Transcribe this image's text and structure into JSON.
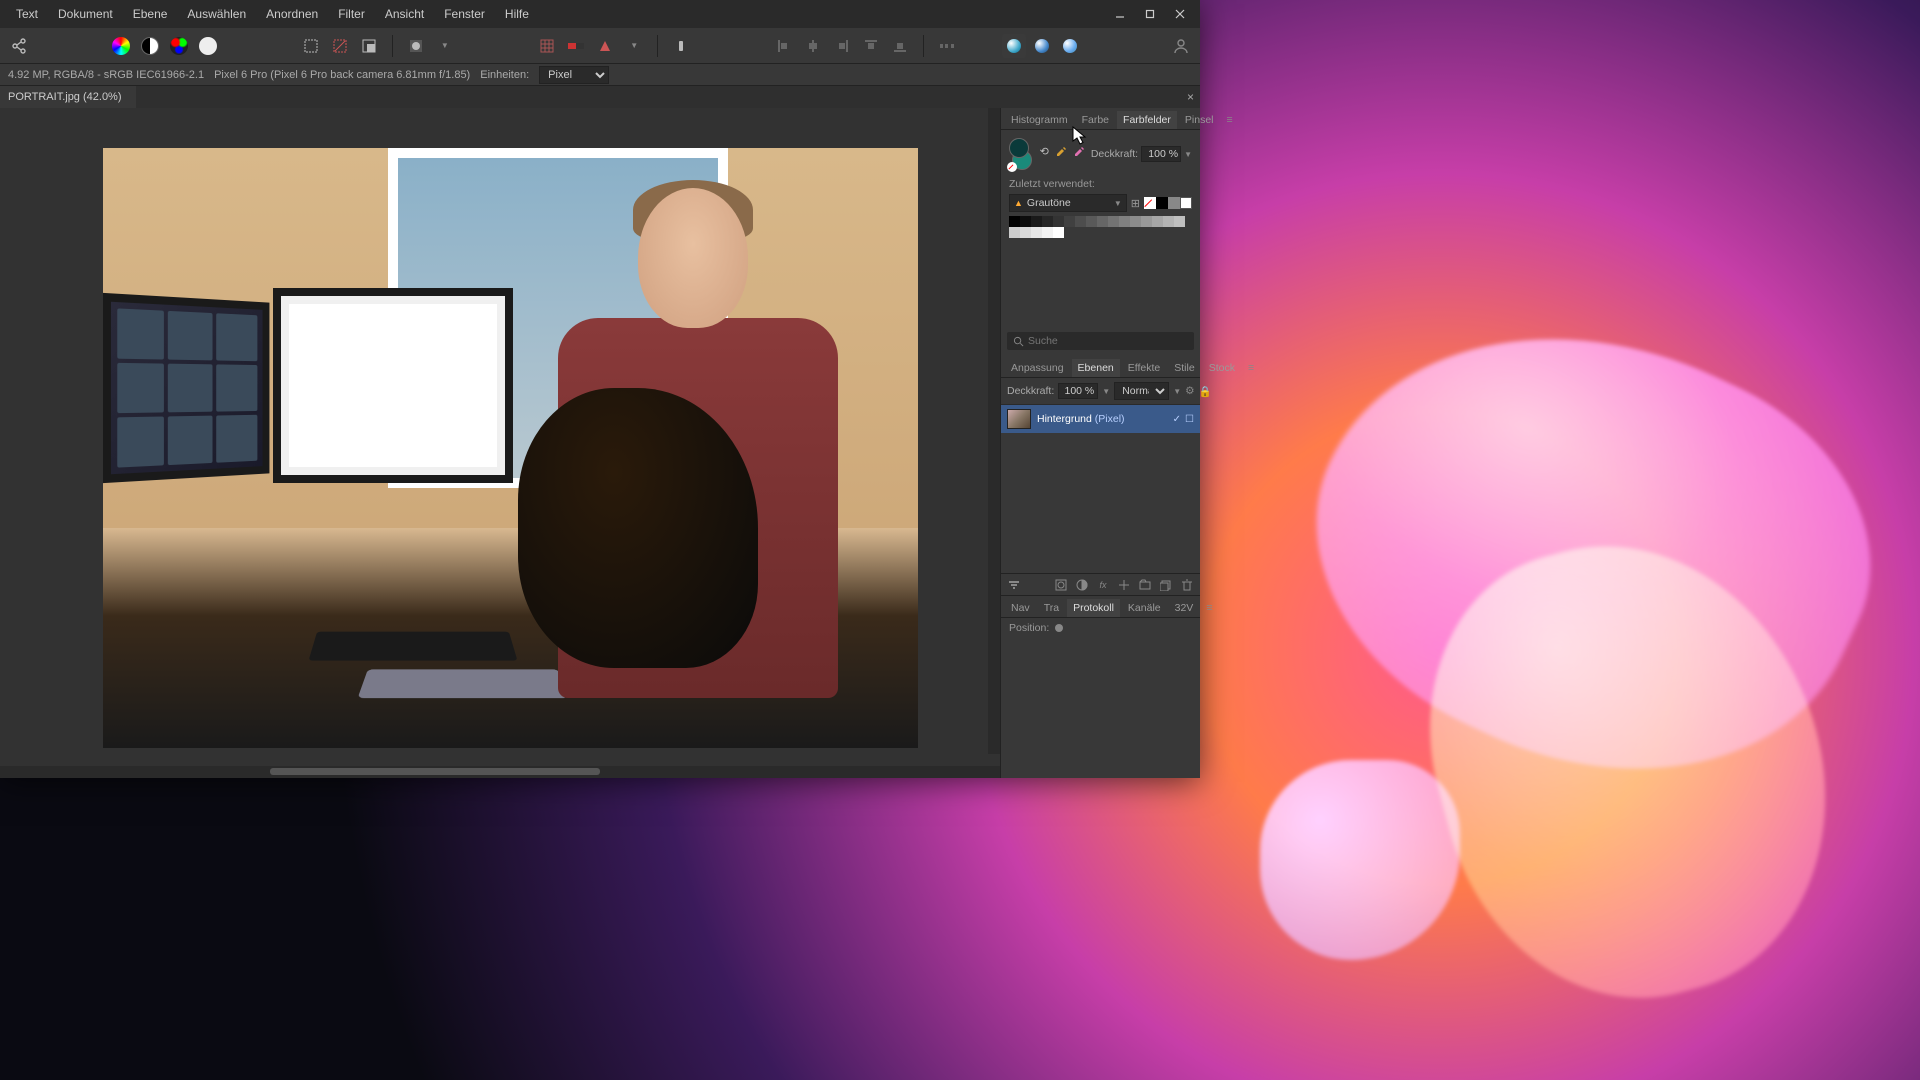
{
  "menubar": [
    "Text",
    "Dokument",
    "Ebene",
    "Auswählen",
    "Anordnen",
    "Filter",
    "Ansicht",
    "Fenster",
    "Hilfe"
  ],
  "infobar": {
    "resolution": "4.92 MP, RGBA/8 - sRGB IEC61966-2.1",
    "camera": "Pixel 6 Pro (Pixel 6 Pro back camera 6.81mm f/1.85)",
    "units_label": "Einheiten:",
    "units_value": "Pixel"
  },
  "doc_tab": {
    "title": "PORTRAIT.jpg (42.0%)"
  },
  "panels": {
    "color_tabs": [
      "Histogramm",
      "Farbe",
      "Farbfelder",
      "Pinsel"
    ],
    "color_active": "Farbfelder",
    "opacity_label": "Deckkraft:",
    "opacity_value": "100 %",
    "recent_label": "Zuletzt verwendet:",
    "palette_name": "Grautöne",
    "search_placeholder": "Suche",
    "layer_tabs": [
      "Anpassung",
      "Ebenen",
      "Effekte",
      "Stile",
      "Stock"
    ],
    "layer_active": "Ebenen",
    "layer_opacity_label": "Deckkraft:",
    "layer_opacity_value": "100 %",
    "blend_mode": "Normal",
    "layer_name": "Hintergrund",
    "layer_suffix": "(Pixel)",
    "history_tabs": [
      "Nav",
      "Tra",
      "Protokoll",
      "Kanäle",
      "32V"
    ],
    "history_active": "Protokoll",
    "position_label": "Position:"
  },
  "grayscale_swatches": [
    "#000000",
    "#0d0d0d",
    "#1a1a1a",
    "#262626",
    "#333333",
    "#404040",
    "#4d4d4d",
    "#595959",
    "#666666",
    "#737373",
    "#808080",
    "#8c8c8c",
    "#999999",
    "#a6a6a6",
    "#b3b3b3",
    "#bfbfbf",
    "#cccccc",
    "#d9d9d9",
    "#e6e6e6",
    "#f2f2f2",
    "#ffffff"
  ]
}
